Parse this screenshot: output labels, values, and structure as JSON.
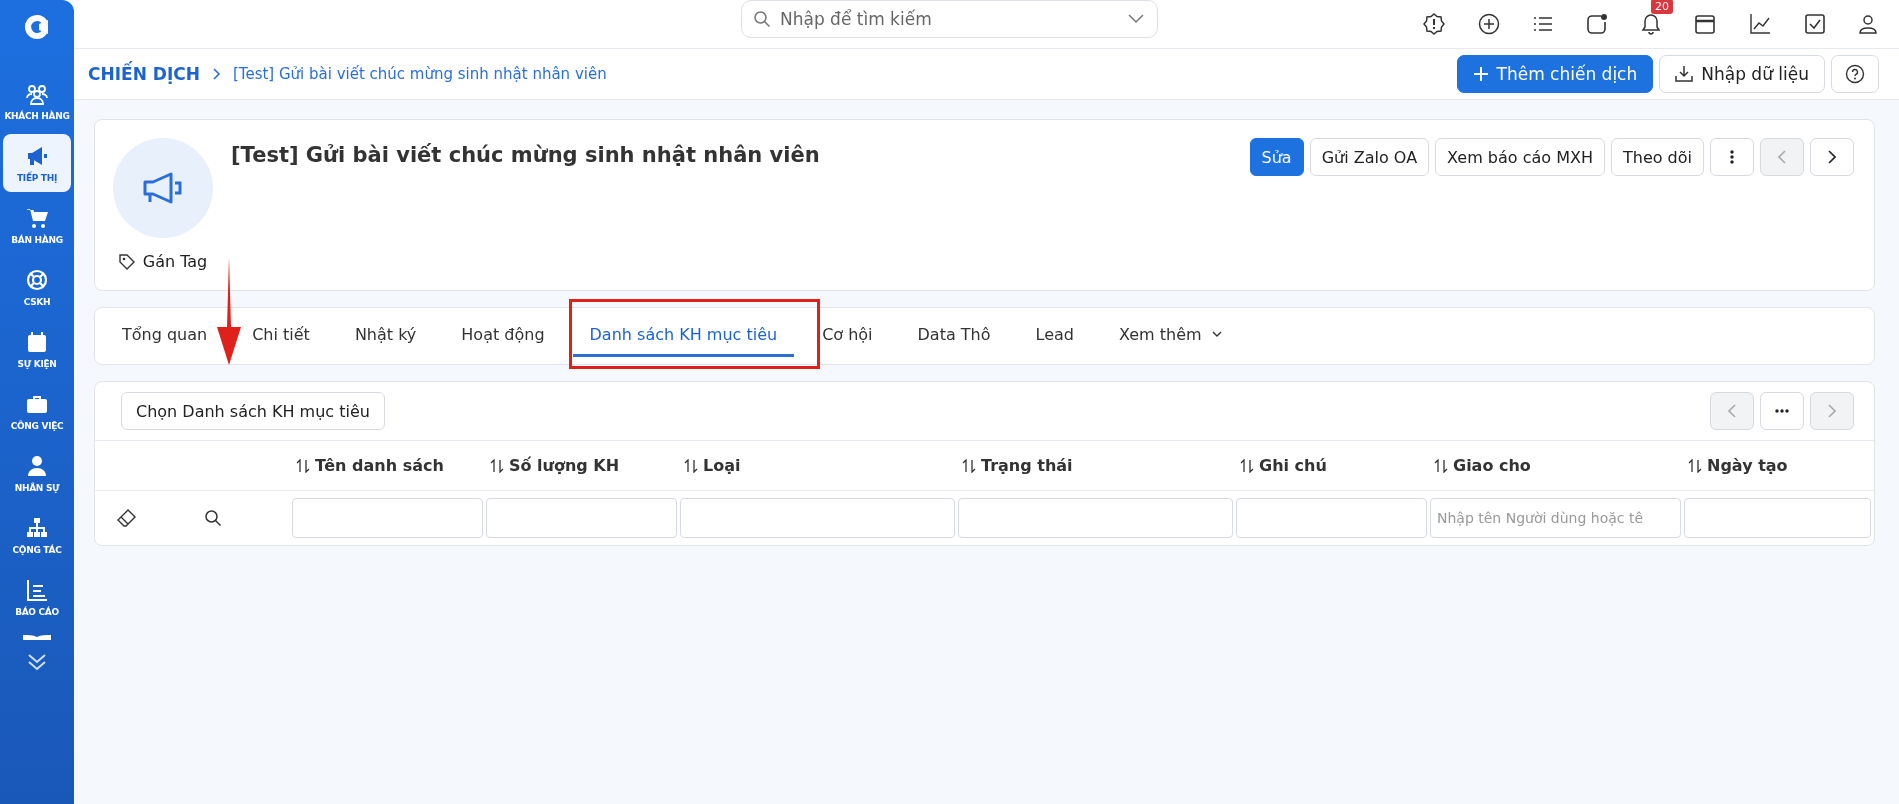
{
  "sidebar": {
    "items": [
      {
        "label": "KHÁCH HÀNG",
        "selected": false
      },
      {
        "label": "TIẾP THỊ",
        "selected": true
      },
      {
        "label": "BÁN HÀNG",
        "selected": false
      },
      {
        "label": "CSKH",
        "selected": false
      },
      {
        "label": "SỰ KIỆN",
        "selected": false
      },
      {
        "label": "CÔNG VIỆC",
        "selected": false
      },
      {
        "label": "NHÂN SỰ",
        "selected": false
      },
      {
        "label": "CỘNG TÁC",
        "selected": false
      },
      {
        "label": "BÁO CÁO",
        "selected": false
      }
    ]
  },
  "search": {
    "placeholder": "Nhập để tìm kiếm"
  },
  "notifications": {
    "badge": "20"
  },
  "breadcrumb": {
    "root": "CHIẾN DỊCH",
    "current": "[Test] Gửi bài viết chúc mừng sinh nhật nhân viên"
  },
  "header_buttons": [
    {
      "label": "Thêm chiến dịch",
      "kind": "primary"
    },
    {
      "label": "Nhập dữ liệu",
      "kind": "import"
    }
  ],
  "campaign": {
    "title": "[Test] Gửi bài viết chúc mừng sinh nhật nhân viên",
    "tag_label": "Gán Tag",
    "actions": [
      {
        "label": "Sửa",
        "kind": "primary"
      },
      {
        "label": "Gửi Zalo OA",
        "kind": "default"
      },
      {
        "label": "Xem báo cáo MXH",
        "kind": "default"
      },
      {
        "label": "Theo dõi",
        "kind": "default"
      }
    ],
    "prev_disabled": true,
    "next_disabled": false
  },
  "tabs": [
    {
      "label": "Tổng quan",
      "selected": false
    },
    {
      "label": "Chi tiết",
      "selected": false
    },
    {
      "label": "Nhật ký",
      "selected": false
    },
    {
      "label": "Hoạt động",
      "selected": false
    },
    {
      "label": "Danh sách KH mục tiêu",
      "selected": true
    },
    {
      "label": "Cơ hội",
      "selected": false
    },
    {
      "label": "Data Thô",
      "selected": false
    },
    {
      "label": "Lead",
      "selected": false
    }
  ],
  "more_tab": "Xem thêm",
  "list": {
    "choose_button": "Chọn Danh sách KH mục tiêu",
    "prev_disabled": true,
    "next_disabled": true,
    "columns": [
      {
        "label": "Tên danh sách"
      },
      {
        "label": "Số lượng KH"
      },
      {
        "label": "Loại"
      },
      {
        "label": "Trạng thái"
      },
      {
        "label": "Ghi chú"
      },
      {
        "label": "Giao cho",
        "placeholder": "Nhập tên Người dùng hoặc tê"
      },
      {
        "label": "Ngày tạo"
      }
    ]
  }
}
